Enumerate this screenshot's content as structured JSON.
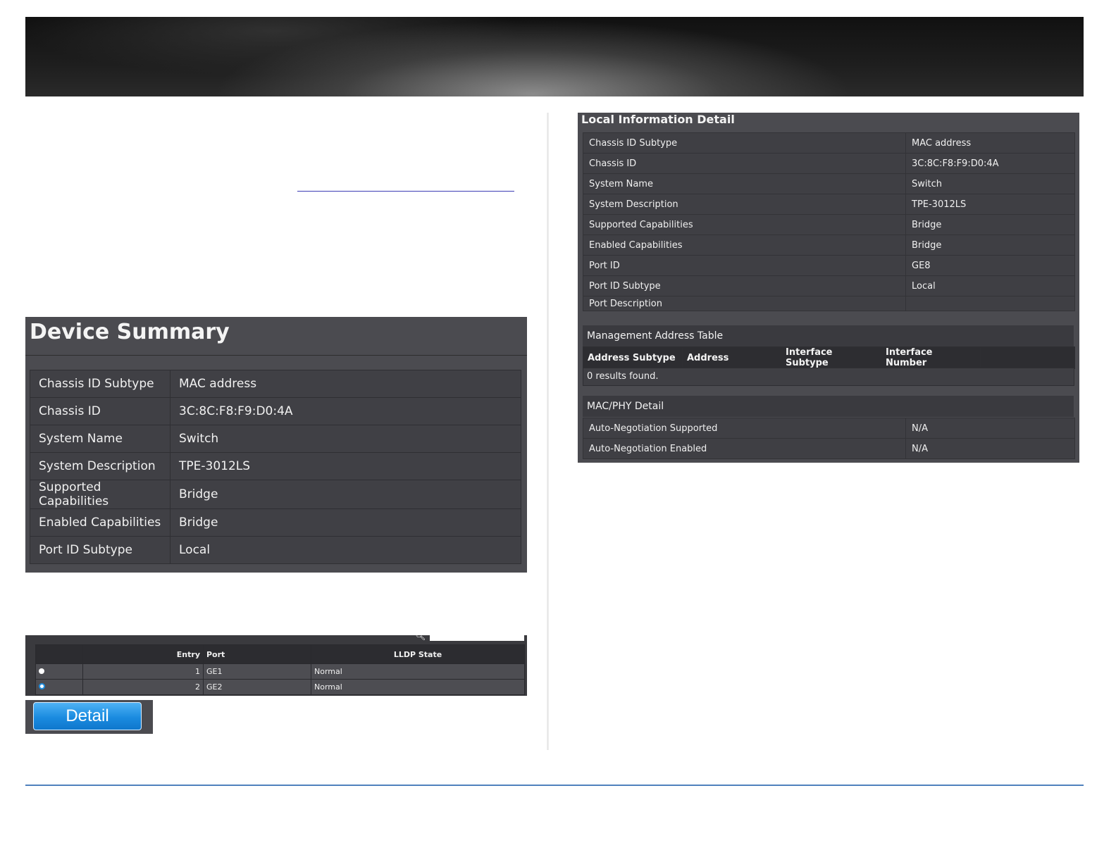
{
  "device_summary": {
    "title": "Device Summary",
    "rows": [
      {
        "label": "Chassis ID Subtype",
        "value": "MAC address"
      },
      {
        "label": "Chassis ID",
        "value": "3C:8C:F8:F9:D0:4A"
      },
      {
        "label": "System Name",
        "value": "Switch"
      },
      {
        "label": "System Description",
        "value": "TPE-3012LS"
      },
      {
        "label": "Supported Capabilities",
        "value": "Bridge"
      },
      {
        "label": "Enabled Capabilities",
        "value": "Bridge"
      },
      {
        "label": "Port ID Subtype",
        "value": "Local"
      }
    ]
  },
  "lldp_table": {
    "headers": {
      "entry": "Entry",
      "port": "Port",
      "state": "LLDP State"
    },
    "rows": [
      {
        "entry": "1",
        "port": "GE1",
        "state": "Normal",
        "selected": false
      },
      {
        "entry": "2",
        "port": "GE2",
        "state": "Normal",
        "selected": true
      }
    ],
    "detail_button": "Detail"
  },
  "local_information_detail": {
    "title": "Local Information Detail",
    "rows": [
      {
        "label": "Chassis ID Subtype",
        "value": "MAC address"
      },
      {
        "label": "Chassis ID",
        "value": "3C:8C:F8:F9:D0:4A"
      },
      {
        "label": "System Name",
        "value": "Switch"
      },
      {
        "label": "System Description",
        "value": "TPE-3012LS"
      },
      {
        "label": "Supported Capabilities",
        "value": "Bridge"
      },
      {
        "label": "Enabled Capabilities",
        "value": "Bridge"
      },
      {
        "label": "Port ID",
        "value": "GE8"
      },
      {
        "label": "Port ID Subtype",
        "value": "Local"
      },
      {
        "label": "Port Description",
        "value": ""
      }
    ],
    "management_address_table": {
      "title": "Management Address Table",
      "headers": [
        "Address Subtype",
        "Address",
        "Interface Subtype",
        "Interface Number"
      ],
      "empty_message": "0 results found."
    },
    "mac_phy_detail": {
      "title": "MAC/PHY Detail",
      "rows": [
        {
          "label": "Auto-Negotiation Supported",
          "value": "N/A"
        },
        {
          "label": "Auto-Negotiation Enabled",
          "value": "N/A"
        }
      ]
    }
  },
  "colors": {
    "accent": "#1a8be0",
    "panel": "#4b4b50",
    "footer_rule": "#4f81bd"
  }
}
